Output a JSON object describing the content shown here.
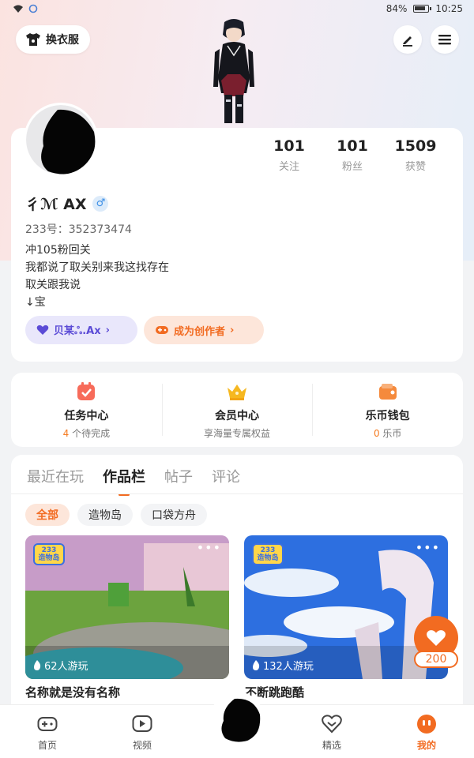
{
  "status_bar": {
    "battery": "84%",
    "time": "10:25"
  },
  "header": {
    "outfit_label": "换衣服"
  },
  "profile": {
    "nickname": "彳ℳ AX",
    "gender": "♂",
    "uid": "233号：352373474",
    "bio": [
      "冲105粉回关",
      "我都说了取关别来我这找存在",
      "取关跟我说",
      "↓宝"
    ],
    "stats": [
      {
        "num": "101",
        "label": "关注"
      },
      {
        "num": "101",
        "label": "粉丝"
      },
      {
        "num": "1509",
        "label": "获赞"
      }
    ],
    "fan_chip": "贝某ஃ.Ax",
    "creator_chip": "成为创作者"
  },
  "services": [
    {
      "title": "任务中心",
      "count": "4",
      "sub": "个待完成"
    },
    {
      "title": "会员中心",
      "sub": "享海量专属权益"
    },
    {
      "title": "乐币钱包",
      "count": "0",
      "sub": "乐币"
    }
  ],
  "tabs": [
    "最近在玩",
    "作品栏",
    "帖子",
    "评论"
  ],
  "filters": [
    "全部",
    "造物岛",
    "口袋方舟"
  ],
  "games": [
    {
      "name": "名称就是没有名称",
      "plays": "62人游玩",
      "logo": "233\n造物岛"
    },
    {
      "name": "不断跳跑酷",
      "plays": "132人游玩",
      "logo": "233\n造物岛"
    }
  ],
  "like": {
    "count": "200"
  },
  "nav": [
    {
      "label": "首页"
    },
    {
      "label": "视频"
    },
    {
      "label": "精选"
    },
    {
      "label": "我的"
    }
  ],
  "colors": {
    "accent": "#f26b21",
    "purple": "#5b4bd6"
  }
}
